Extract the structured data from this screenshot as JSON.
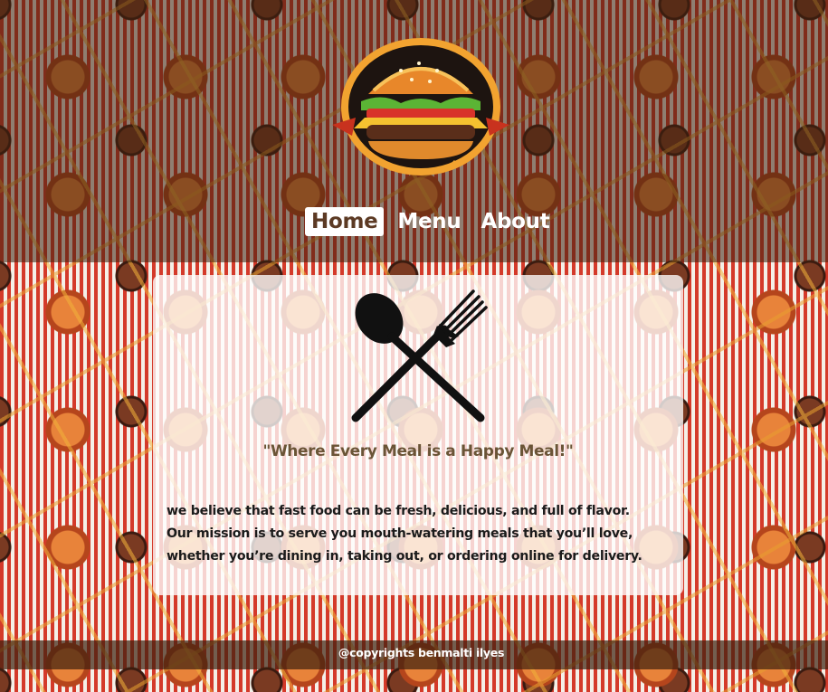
{
  "nav": {
    "items": [
      {
        "label": "Home",
        "active": true
      },
      {
        "label": "Menu",
        "active": false
      },
      {
        "label": "About",
        "active": false
      }
    ]
  },
  "hero": {
    "logo_icon": "burger-logo-icon",
    "utensils_icon": "spoon-fork-icon",
    "tagline": "\"Where Every Meal is a Happy Meal!\"",
    "mission_lines": [
      "we believe that fast food can be fresh, delicious, and full of flavor.",
      "Our mission is to serve you mouth-watering meals that you’ll love,",
      "whether you’re dining in, taking out, or ordering online for delivery."
    ]
  },
  "footer": {
    "copyright": "@copyrights benmalti ilyes"
  },
  "colors": {
    "nav_active_bg": "#ffffff",
    "nav_active_text": "#5c3a24",
    "tagline": "#6a5436",
    "card_bg": "rgba(255,255,255,0.78)"
  }
}
